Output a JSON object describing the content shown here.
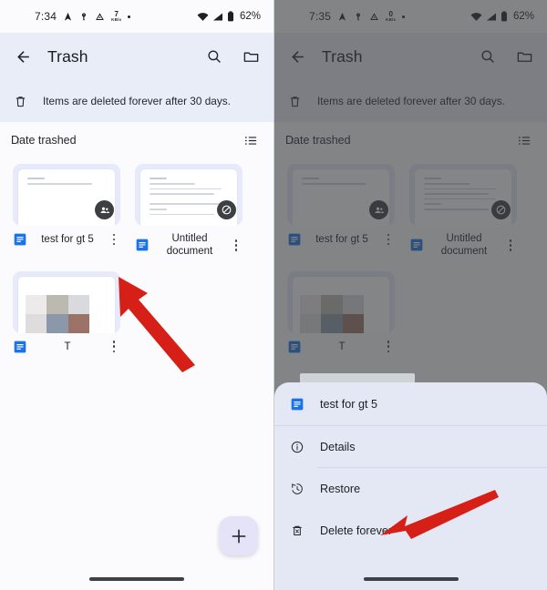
{
  "left": {
    "status": {
      "time": "7:34",
      "net_speed_value": "7",
      "net_speed_unit": "KB/s",
      "battery": "62%",
      "icons": [
        "navigation-icon",
        "vpn-key-icon",
        "drive-sync-icon",
        "network-speed-icon",
        "dot-icon",
        "wifi-icon",
        "signal-icon",
        "battery-icon"
      ]
    },
    "appbar": {
      "back_label": "back-arrow",
      "title": "Trash",
      "search_label": "search-icon",
      "folder_label": "folder-icon"
    },
    "banner": {
      "icon": "trash-icon",
      "text": "Items are deleted forever after 30 days."
    },
    "sort": {
      "label": "Date trashed",
      "direction_arrow": "↑",
      "view_toggle": "list-view-icon"
    },
    "files": [
      {
        "name": "test for gt 5",
        "type_icon": "google-docs-icon",
        "badge": "shared-people-icon",
        "thumb": "document"
      },
      {
        "name": "Untitled document",
        "type_icon": "google-docs-icon",
        "badge": "restricted-icon",
        "thumb": "document"
      },
      {
        "name": "T",
        "type_icon": "google-docs-icon",
        "badge": "",
        "thumb": "mosaic"
      }
    ],
    "fab": {
      "label": "+",
      "name": "new-item-button"
    }
  },
  "right": {
    "status": {
      "time": "7:35",
      "net_speed_value": "0",
      "net_speed_unit": "KB/s",
      "battery": "62%"
    },
    "appbar": {
      "title": "Trash"
    },
    "banner": {
      "text": "Items are deleted forever after 30 days."
    },
    "sort": {
      "label": "Date trashed",
      "direction_arrow": "↑"
    },
    "files": [
      {
        "name": "test for gt 5",
        "type_icon": "google-docs-icon",
        "badge": "shared-people-icon"
      },
      {
        "name": "Untitled document",
        "type_icon": "google-docs-icon",
        "badge": "restricted-icon"
      },
      {
        "name": "T",
        "type_icon": "google-docs-icon",
        "badge": ""
      }
    ],
    "sheet": {
      "header": {
        "title": "test for gt 5",
        "icon": "google-docs-icon"
      },
      "items": [
        {
          "label": "Details",
          "icon": "info-icon"
        },
        {
          "label": "Restore",
          "icon": "restore-icon"
        },
        {
          "label": "Delete forever",
          "icon": "delete-forever-icon"
        }
      ]
    }
  },
  "annotations": {
    "arrow_color": "#d61f16",
    "left_arrow_target": "overflow-menu-test-for-gt-5",
    "right_arrow_target": "delete-forever-item"
  },
  "colors": {
    "appbar_bg": "#e9edf8",
    "page_bg": "#fbfbfd",
    "sheet_bg": "#e3e8f4",
    "docs_blue": "#1a73e8",
    "fab_bg": "#e4e3f8",
    "scrim": "rgba(56,58,62,0.62)"
  }
}
